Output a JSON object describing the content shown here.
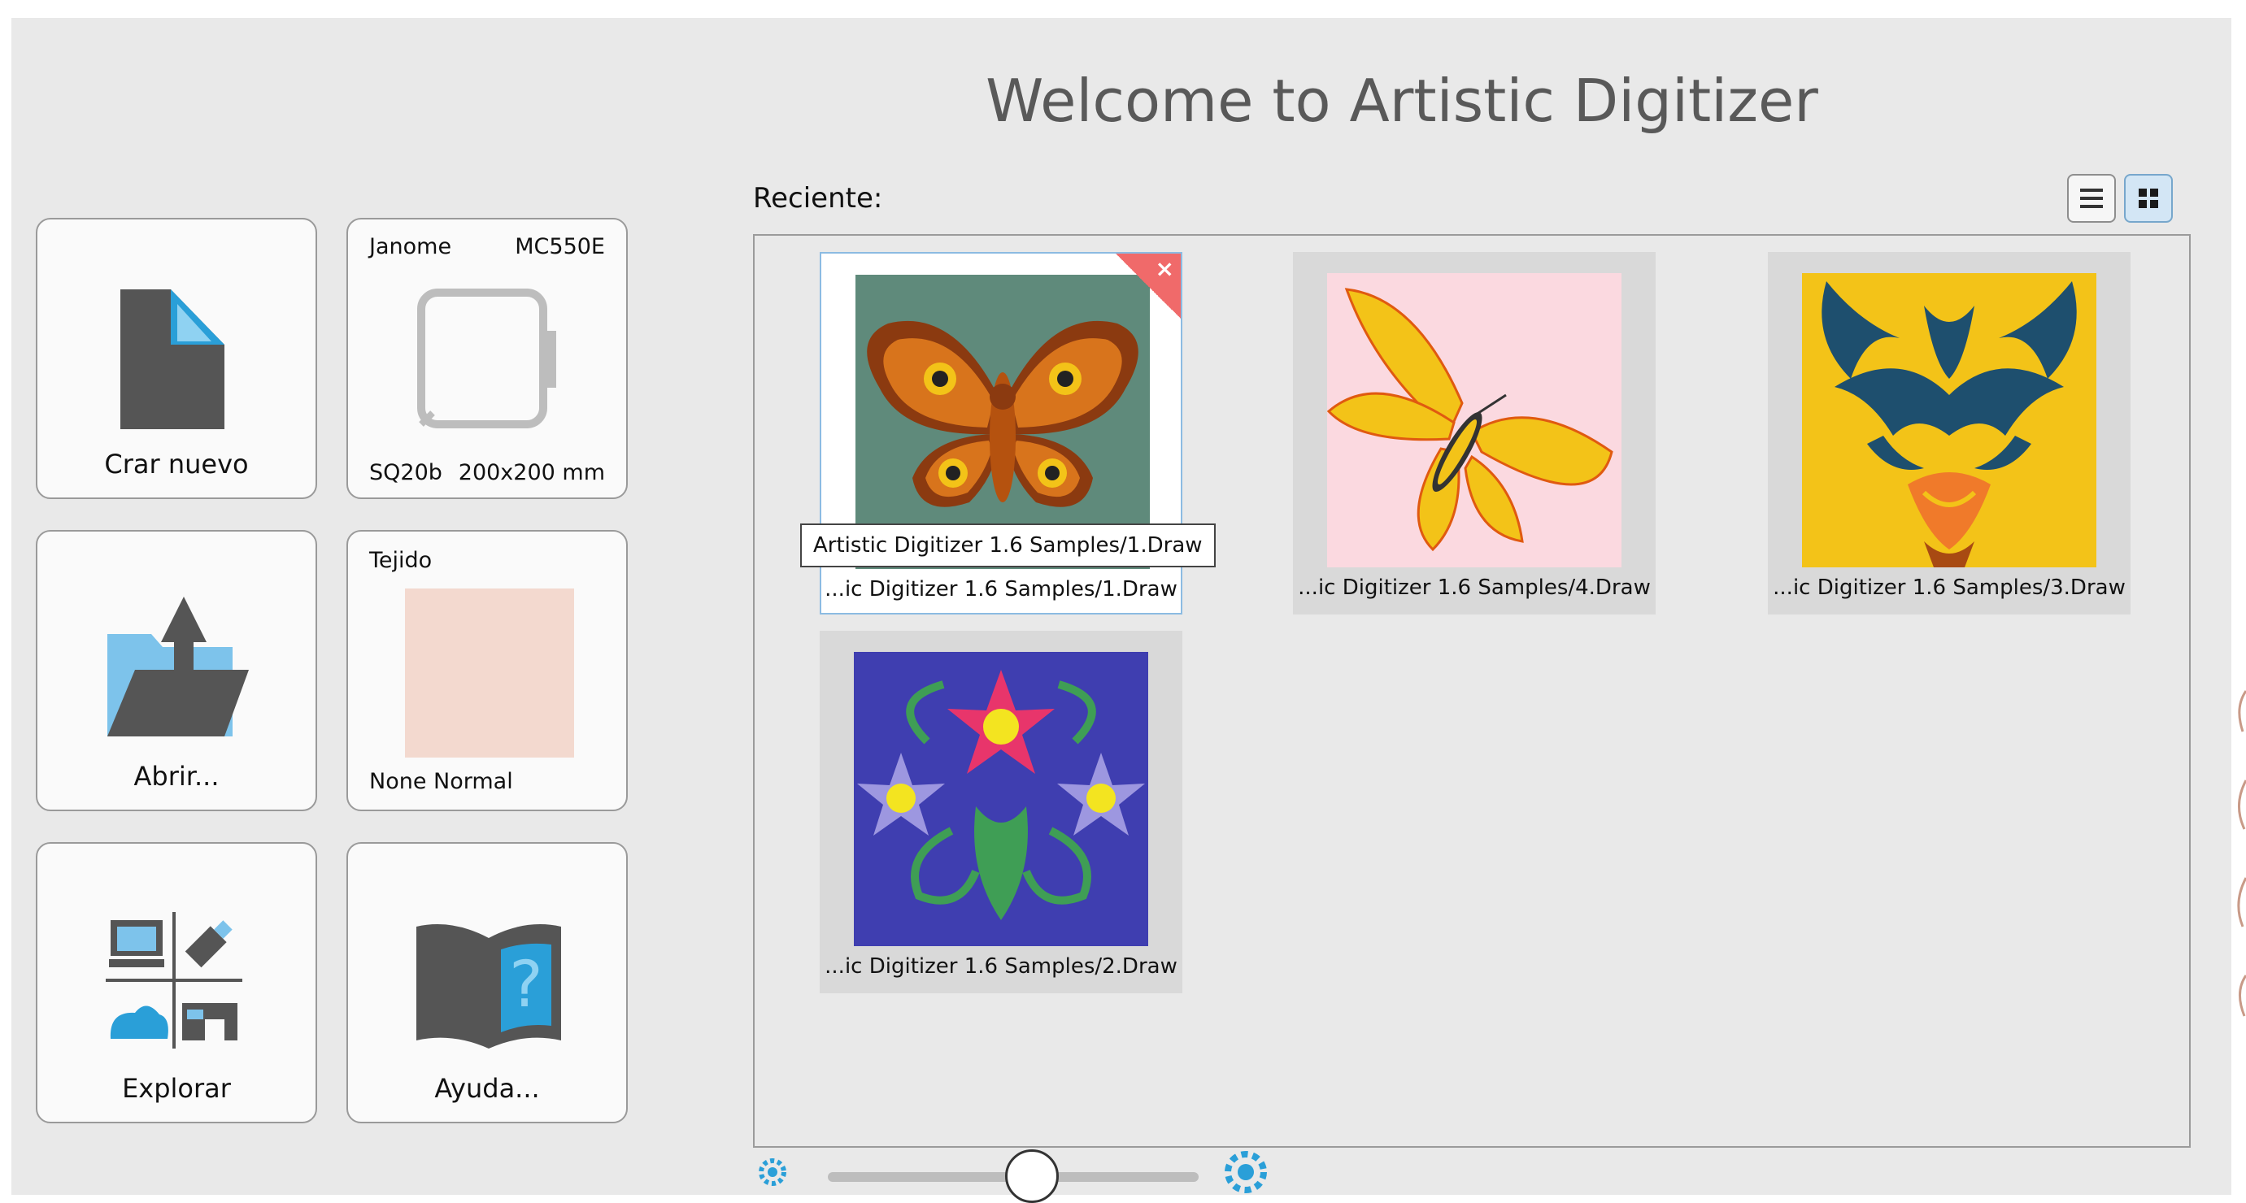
{
  "title": "Welcome to Artistic Digitizer",
  "cards": {
    "create_new": "Crar nuevo",
    "open": "Abrir...",
    "explore": "Explorar",
    "help": "Ayuda...",
    "machine": {
      "brand": "Janome",
      "model": "MC550E",
      "hoop": "SQ20b",
      "size": "200x200 mm"
    },
    "fabric": {
      "label": "Tejido",
      "value": "None Normal",
      "swatch_color": "#f3d9cf"
    }
  },
  "recent": {
    "label": "Reciente:",
    "items": [
      {
        "caption": "...ic Digitizer 1.6 Samples/1.Draw",
        "art": "moth-icon",
        "bg": "#5f8a7b"
      },
      {
        "caption": "...ic Digitizer 1.6 Samples/4.Draw",
        "art": "butterfly-icon",
        "bg": "#fbd9e0"
      },
      {
        "caption": "...ic Digitizer 1.6 Samples/3.Draw",
        "art": "tiger-icon",
        "bg": "#f3c318"
      },
      {
        "caption": "...ic Digitizer 1.6 Samples/2.Draw",
        "art": "flowers-icon",
        "bg": "#3f3eb0"
      }
    ],
    "tooltip": "Artistic Digitizer 1.6 Samples/1.Draw",
    "remove_symbol": "×"
  },
  "view_toggle": {
    "list": "list-view-icon",
    "grid": "grid-view-icon",
    "active": "grid"
  },
  "zoom": {
    "level": 0.55,
    "min_icon": "gear-small-icon",
    "max_icon": "gear-large-icon"
  },
  "colors": {
    "accent": "#2a9fd8",
    "icon_dark": "#555555",
    "remove": "#f06a6a"
  }
}
